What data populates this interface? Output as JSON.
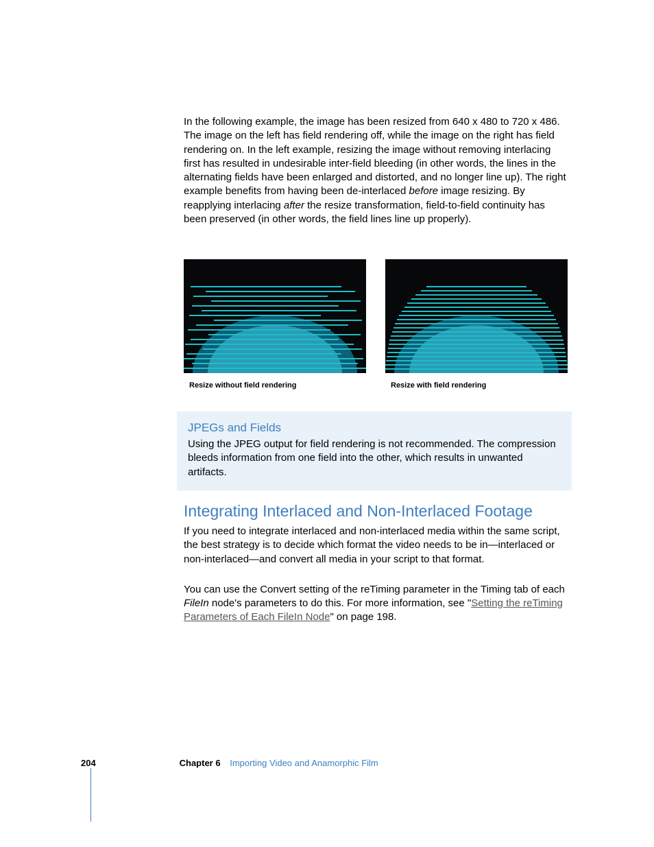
{
  "intro": {
    "pre": "In the following example, the image has been resized from 640 x 480 to 720 x 486. The image on the left has field rendering off, while the image on the right has field rendering on. In the left example, resizing the image without removing interlacing first has resulted in undesirable inter-field bleeding (in other words, the lines in the alternating fields have been enlarged and distorted, and no longer line up). The right example benefits from having been de-interlaced ",
    "em1": "before",
    "mid": " image resizing. By reapplying interlacing ",
    "em2": "after",
    "post": " the resize transformation, field-to-field continuity has been preserved (in other words, the field lines line up properly)."
  },
  "figures": {
    "left_caption": "Resize without field rendering",
    "right_caption": "Resize with field rendering"
  },
  "callout": {
    "heading": "JPEGs and Fields",
    "body": "Using the JPEG output for field rendering is not recommended. The compression bleeds information from one field into the other, which results in unwanted artifacts."
  },
  "section": {
    "heading": "Integrating Interlaced and Non-Interlaced Footage",
    "p1": "If you need to integrate interlaced and non-interlaced media within the same script, the best strategy is to decide which format the video needs to be in—interlaced or non-interlaced—and convert all media in your script to that format.",
    "p2_pre": "You can use the Convert setting of the reTiming parameter in the Timing tab of each ",
    "p2_em": "FileIn",
    "p2_mid": " node's parameters to do this. For more information, see \"",
    "p2_link": "Setting the reTiming Parameters of Each FileIn Node",
    "p2_post": "\" on page 198."
  },
  "footer": {
    "page": "204",
    "chapter_label": "Chapter 6",
    "chapter_title": "Importing Video and Anamorphic Film"
  }
}
